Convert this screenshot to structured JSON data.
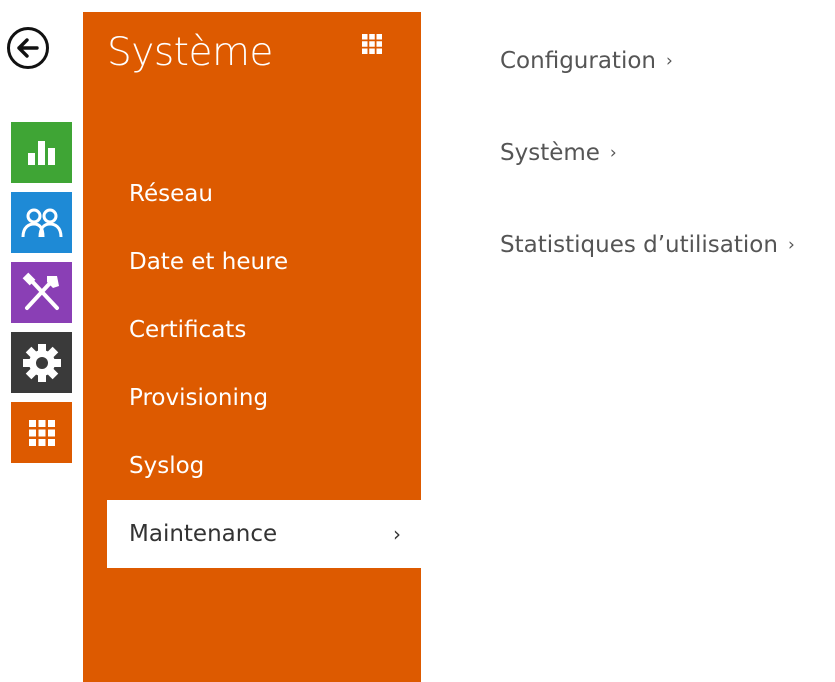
{
  "panel": {
    "title": "Système",
    "menu": [
      {
        "label": "Réseau"
      },
      {
        "label": "Date et heure"
      },
      {
        "label": "Certificats"
      },
      {
        "label": "Provisioning"
      },
      {
        "label": "Syslog"
      },
      {
        "label": "Maintenance",
        "active": true,
        "chevron": "›"
      }
    ]
  },
  "links": [
    {
      "label": "Configuration",
      "chevron": "›"
    },
    {
      "label": "Système",
      "chevron": "›"
    },
    {
      "label": "Statistiques d’utilisation",
      "chevron": "›"
    }
  ],
  "rail": [
    {
      "icon": "bar-chart-icon",
      "color": "#3fa535"
    },
    {
      "icon": "users-icon",
      "color": "#1e8ad6"
    },
    {
      "icon": "tools-icon",
      "color": "#8a3fb5"
    },
    {
      "icon": "gear-icon",
      "color": "#3a3a3a"
    },
    {
      "icon": "grid-icon",
      "color": "#dd5a00"
    }
  ],
  "colors": {
    "accent": "#dd5a00",
    "text_link": "#555555"
  }
}
